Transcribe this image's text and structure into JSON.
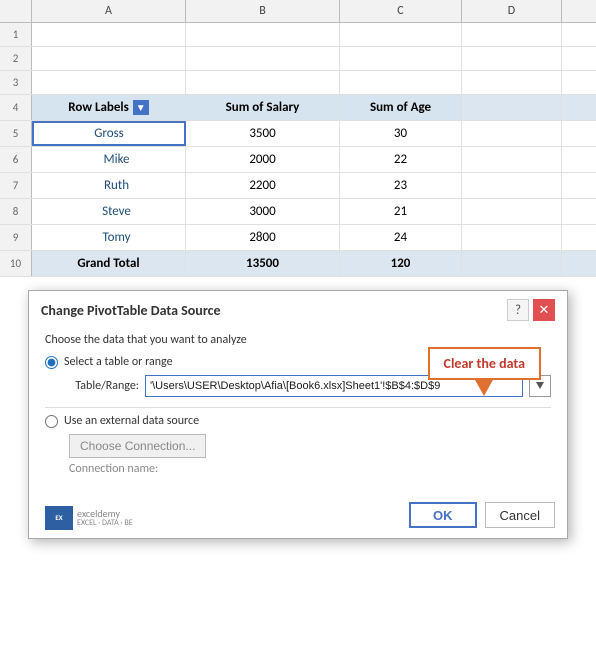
{
  "columns": {
    "a": "A",
    "b": "B",
    "c": "C",
    "d": "D"
  },
  "rows": [
    {
      "num": "1",
      "a": "",
      "b": "",
      "c": "",
      "d": ""
    },
    {
      "num": "2",
      "a": "",
      "b": "",
      "c": "",
      "d": ""
    },
    {
      "num": "3",
      "a": "",
      "b": "",
      "c": "",
      "d": ""
    },
    {
      "num": "4",
      "a": "Row Labels",
      "b": "Sum of Salary",
      "c": "Sum of Age",
      "d": "",
      "type": "header"
    },
    {
      "num": "5",
      "a": "Gross",
      "b": "3500",
      "c": "30",
      "d": "",
      "type": "gross"
    },
    {
      "num": "6",
      "a": "Mike",
      "b": "2000",
      "c": "22",
      "d": ""
    },
    {
      "num": "7",
      "a": "Ruth",
      "b": "2200",
      "c": "23",
      "d": ""
    },
    {
      "num": "8",
      "a": "Steve",
      "b": "3000",
      "c": "21",
      "d": ""
    },
    {
      "num": "9",
      "a": "Tomy",
      "b": "2800",
      "c": "24",
      "d": ""
    },
    {
      "num": "10",
      "a": "Grand Total",
      "b": "13500",
      "c": "120",
      "d": "",
      "type": "grand"
    }
  ],
  "dialog": {
    "title": "Change PivotTable Data Source",
    "subtitle": "Choose the data that you want to analyze",
    "radio1_label": "Select a table or range",
    "table_range_label": "Table/Range:",
    "table_range_value": "'\\Users\\USER\\Desktop\\Afia\\[Book6.xlsx]Sheet1'!$B$4:$D$9",
    "radio2_label": "Use an external data source",
    "choose_conn_label": "Choose Connection...",
    "conn_name_label": "Connection name:",
    "ok_label": "OK",
    "cancel_label": "Cancel",
    "help_label": "?",
    "logo_line1": "exceldemy",
    "logo_line2": "EXCEL · DATA · BE"
  },
  "callout": {
    "text": "Clear the data"
  },
  "down_arrow": "⬇"
}
